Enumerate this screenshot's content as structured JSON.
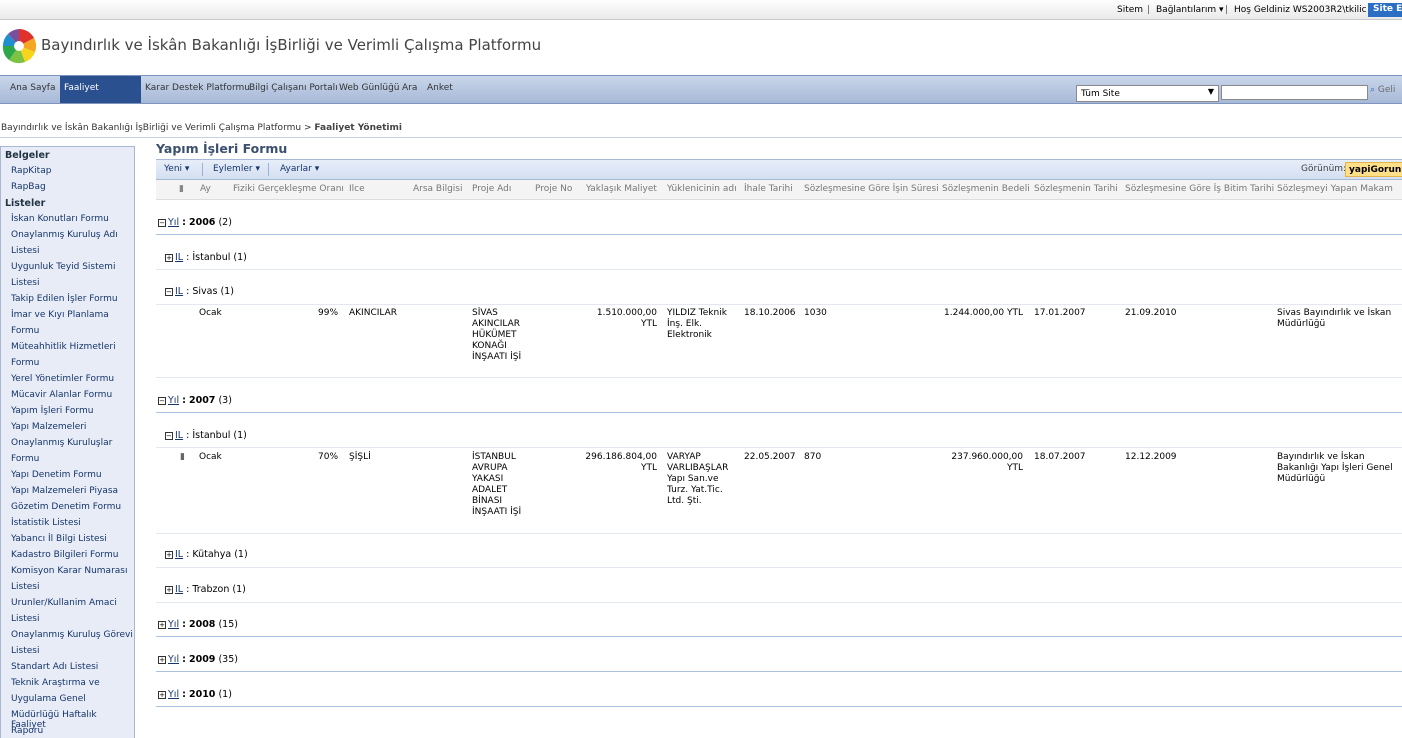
{
  "global_bar": {
    "site_map": "Sitem",
    "my_links": "Bağlantılarım",
    "welcome": "Hoş Geldiniz WS2003R2\\tkilic",
    "site_actions": "Site E"
  },
  "site_title": "Bayındırlık ve İskân Bakanlığı İşBirliği ve Verimli Çalışma Platformu",
  "top_nav": {
    "tabs": [
      "Ana Sayfa",
      "Faaliyet Yönetimi",
      "Karar Destek Platformu",
      "Bilgi Çalışanı Portalı",
      "Web Günlüğü",
      "Ara",
      "Anket"
    ],
    "selected": "Faaliyet Yönetimi"
  },
  "search": {
    "scope": "Tüm Site",
    "go_label": "Geli"
  },
  "breadcrumb": {
    "root": "Bayındırlık ve İskân Bakanlığı İşBirliği ve Verimli Çalışma Platformu",
    "separator": ">",
    "current": "Faaliyet Yönetimi"
  },
  "quick_launch": {
    "documents_header": "Belgeler",
    "documents": [
      "RapKitap",
      "RapBag"
    ],
    "lists_header": "Listeler",
    "lists": [
      "İskan Konutları Formu",
      "Onaylanmış Kuruluş Adı",
      "Listesi",
      "Uygunluk Teyid Sistemi",
      "Listesi",
      "Takip Edilen İşler Formu",
      "İmar ve Kıyı Planlama",
      "Formu",
      "Müteahhitlik Hizmetleri",
      "Formu",
      "Yerel Yönetimler Formu",
      "Mücavir Alanlar Formu",
      "Yapım İşleri Formu",
      "Yapı Malzemeleri",
      "Onaylanmış Kuruluşlar",
      "Formu",
      "Yapı Denetim Formu",
      "Yapı Malzemeleri Piyasa",
      "Gözetim Denetim Formu",
      "İstatistik Listesi",
      "Yabancı İl Bilgi Listesi",
      "Kadastro Bilgileri Formu",
      "Komisyon Karar Numarası",
      "Listesi",
      "Urunler/Kullanim Amaci",
      "Listesi",
      "Onaylanmış Kuruluş Görevi",
      "Listesi",
      "Standart Adı Listesi",
      "Teknik Araştırma ve",
      "Uygulama Genel",
      "Müdürlüğü Haftalık Faaliyet",
      "Raporu"
    ]
  },
  "list": {
    "title": "Yapım İşleri Formu",
    "toolbar": {
      "new": "Yeni",
      "actions": "Eylemler",
      "settings": "Ayarlar",
      "view_label": "Görünüm:",
      "view_value": "yapiGorunu"
    },
    "columns": [
      "Ay",
      "Fiziki Gerçekleşme Oranı",
      "Ilce",
      "Arsa Bilgisi",
      "Proje Adı",
      "Proje No",
      "Yaklaşık Maliyet",
      "Yüklenicinin adı",
      "İhale Tarihi",
      "Sözleşmesine Göre İşin Süresi",
      "Sözleşmenin Bedeli",
      "Sözleşmenin Tarihi",
      "Sözleşmesine Göre İş Bitim Tarihi",
      "Sözleşmeyi Yapan Makam"
    ],
    "year_field": "Yıl",
    "city_field": "IL",
    "groups": {
      "y2006": {
        "year": "2006",
        "count": "(2)",
        "toggle": "−"
      },
      "y2006_istanbul": {
        "city": "İstanbul",
        "count": "(1)",
        "toggle": "+"
      },
      "y2006_sivas": {
        "city": "Sivas",
        "count": "(1)",
        "toggle": "−"
      },
      "y2007": {
        "year": "2007",
        "count": "(3)",
        "toggle": "−"
      },
      "y2007_istanbul": {
        "city": "İstanbul",
        "count": "(1)",
        "toggle": "−"
      },
      "y2007_kutahya": {
        "city": "Kütahya",
        "count": "(1)",
        "toggle": "+"
      },
      "y2007_trabzon": {
        "city": "Trabzon",
        "count": "(1)",
        "toggle": "+"
      },
      "y2008": {
        "year": "2008",
        "count": "(15)",
        "toggle": "+"
      },
      "y2009": {
        "year": "2009",
        "count": "(35)",
        "toggle": "+"
      },
      "y2010": {
        "year": "2010",
        "count": "(1)",
        "toggle": "+"
      }
    },
    "rows": {
      "sivas": {
        "ay": "Ocak",
        "oran": "99%",
        "ilce": "AKINCILAR",
        "proje_adi": "SİVAS AKINCILAR HÜKÜMET KONAĞI İNŞAATI İŞİ",
        "maliyet": "1.510.000,00 YTL",
        "yuklenici": "YILDIZ Teknik İnş. Elk. Elektronik",
        "ihale": "18.10.2006",
        "sure": "1030",
        "bedel": "1.244.000,00 YTL",
        "soz_tarihi": "17.01.2007",
        "bitim": "21.09.2010",
        "makam": "Sivas Bayındırlık ve İskan Müdürlüğü"
      },
      "istanbul": {
        "ay": "Ocak",
        "oran": "70%",
        "ilce": "ŞİŞLİ",
        "proje_adi": "İSTANBUL AVRUPA YAKASI ADALET BİNASI İNŞAATI İŞİ",
        "maliyet": "296.186.804,00 YTL",
        "yuklenici": "VARYAP VARLIBAŞLAR Yapı San.ve Turz. Yat.Tic. Ltd. Şti.",
        "ihale": "22.05.2007",
        "sure": "870",
        "bedel": "237.960.000,00 YTL",
        "soz_tarihi": "18.07.2007",
        "bitim": "12.12.2009",
        "makam": "Bayındırlık ve İskan Bakanlığı Yapı İşleri Genel Müdürlüğü"
      }
    }
  },
  "colors": {
    "nav_selected": "#2b5090",
    "link": "#16356b",
    "view_highlight": "#ffdf88",
    "group_line": "#aac2df"
  },
  "icons": [
    "logo-icon",
    "search-go-icon",
    "attachment-icon",
    "dropdown-arrow-icon",
    "expand-icon",
    "collapse-icon"
  ]
}
